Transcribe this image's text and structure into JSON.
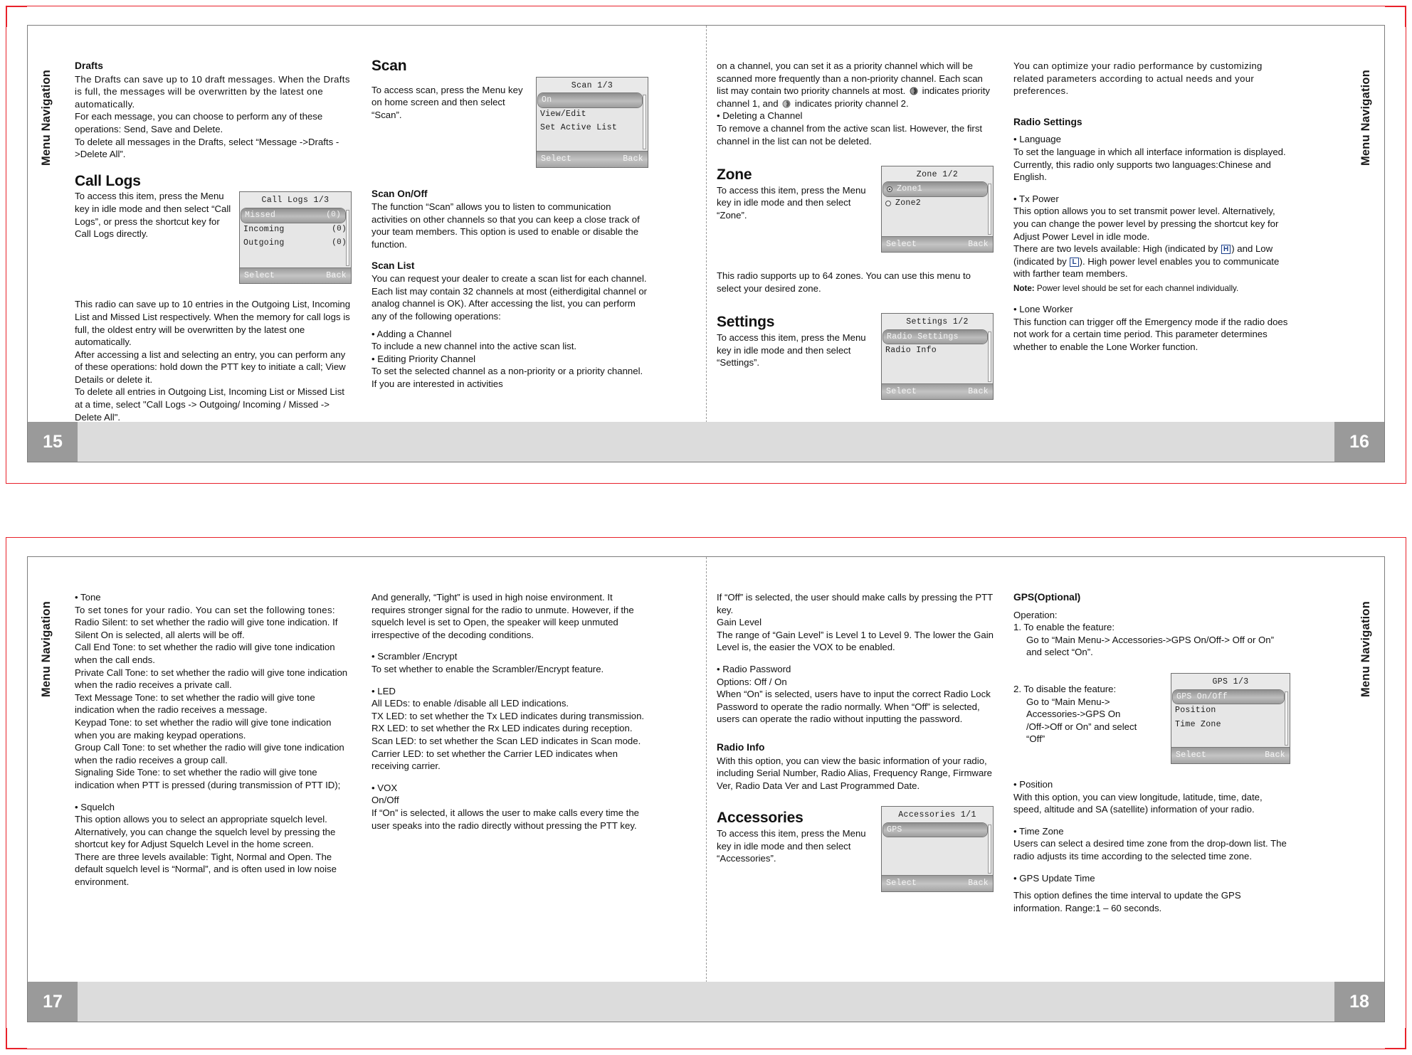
{
  "sidetabs": {
    "label": "Menu Navigation"
  },
  "pages": {
    "p15": {
      "number": "15",
      "col1": {
        "drafts_heading": "Drafts",
        "drafts_p1": "The Drafts can save up to 10 draft messages. When the Drafts is full, the messages will be overwritten by the latest one automatically.",
        "drafts_p2": "For each message, you can choose to perform any of these operations: Send, Save and Delete.",
        "drafts_p3": "To delete all messages in the Drafts, select “Message ->Drafts ->Delete All”.",
        "calllogs_heading": "Call Logs",
        "calllogs_p1": "To access this item, press the Menu key in idle mode and then select “Call Logs”, or press the shortcut key for Call Logs directly.",
        "calllogs_p2": "This radio can save up to 10 entries in the Outgoing List, Incoming List and Missed List respectively. When the memory for call logs is full, the oldest entry will be overwritten by the latest one automatically.",
        "calllogs_p3": "After accessing a list and selecting an entry, you can perform any of these operations: hold down the PTT key to initiate a call; View Details or delete it.",
        "calllogs_p4": "To delete all entries in Outgoing List, Incoming List or Missed List at a time, select \"Call Logs -> Outgoing/ Incoming / Missed -> Delete All\"."
      },
      "col2": {
        "scan_heading": "Scan",
        "scan_p1": "To access scan, press the Menu key on home screen and then select “Scan”.",
        "scanonoff_heading": "Scan On/Off",
        "scanonoff_p1": "The function “Scan” allows you to listen to communication activities on other channels so that you can keep a close track of your team members. This option is used to enable or disable the function.",
        "scanlist_heading": "Scan List",
        "scanlist_p1": "You can request your dealer to create a scan list for each channel. Each list may contain 32 channels at most (eitherdigital channel or analog channel is OK). After accessing the list, you can perform any of the following operations:",
        "bullet_add": "• Adding a Channel",
        "add_p": "To include a new channel into the active scan list.",
        "bullet_edit": "• Editing Priority Channel",
        "edit_p": "To set the selected channel as a non-priority or a priority channel. If you are interested in activities"
      },
      "lcd_scan": {
        "title": "Scan 1/3",
        "rows": [
          "On",
          "View/Edit",
          "Set Active List"
        ],
        "selected_index": 0,
        "softkey_left": "Select",
        "softkey_right": "Back"
      },
      "lcd_calllogs": {
        "title": "Call Logs 1/3",
        "rows": [
          {
            "label": "Missed",
            "count": "(0)"
          },
          {
            "label": "Incoming",
            "count": "(0)"
          },
          {
            "label": "Outgoing",
            "count": "(0)"
          }
        ],
        "selected_index": 0,
        "softkey_left": "Select",
        "softkey_right": "Back"
      }
    },
    "p16": {
      "number": "16",
      "col1": {
        "cont_p1_a": "on a channel, you can set it as a priority channel which will be scanned more frequently than a non-priority channel. Each scan list may contain two priority channels at most.",
        "cont_p1_b": "indicates priority channel 1, and",
        "cont_p1_c": "indicates priority channel 2.",
        "bullet_delete": "• Deleting a Channel",
        "delete_p": "To remove a channel from the active scan list. However, the first channel in the list can not be deleted.",
        "zone_heading": "Zone",
        "zone_p1": "To access this item, press the Menu key in idle mode and then select “Zone”.",
        "zone_p2": "This radio supports up to 64 zones. You can use this menu to select your desired zone.",
        "settings_heading": "Settings",
        "settings_p1": "To access this item, press the Menu key in idle mode and then select “Settings”."
      },
      "col2": {
        "intro_p": "You can optimize your radio performance by customizing related parameters according to actual needs and your preferences.",
        "radiosettings_heading": "Radio Settings",
        "bullet_language": "• Language",
        "language_p": "To set the language in which all interface information is displayed. Currently, this radio only supports two languages:Chinese and English.",
        "bullet_txpower": "• Tx Power",
        "txpower_p1": "This option allows you to set transmit power level. Alternatively, you can change the power level by pressing the shortcut key for Adjust Power Level in idle mode.",
        "txpower_p2_a": "There are two levels available: High (indicated by",
        "txpower_icon_high": "H",
        "txpower_p2_b": ") and Low (indicated by",
        "txpower_icon_low": "L",
        "txpower_p2_c": "). High power level enables you to communicate with farther team members.",
        "note_label": "Note:",
        "note_text": " Power level should be set for each channel individually.",
        "bullet_loneworker": "• Lone Worker",
        "loneworker_p": "This function can trigger off the Emergency mode if the radio does not work for a certain time period. This parameter determines whether to enable the Lone Worker function."
      },
      "lcd_zone": {
        "title": "Zone 1/2",
        "rows": [
          "Zone1",
          "Zone2"
        ],
        "selected_index": 0,
        "softkey_left": "Select",
        "softkey_right": "Back"
      },
      "lcd_settings": {
        "title": "Settings 1/2",
        "rows": [
          "Radio Settings",
          "Radio Info"
        ],
        "selected_index": 0,
        "softkey_left": "Select",
        "softkey_right": "Back"
      }
    },
    "p17": {
      "number": "17",
      "col1": {
        "bullet_tone": "• Tone",
        "tone_p1": "To set tones for your radio. You can set the following tones:",
        "tone_p2": "Radio Silent: to set whether the radio will give tone indication. If Silent On is selected, all alerts will be off.",
        "tone_p3": "Call End Tone: to set whether the radio will give tone indication when the call ends.",
        "tone_p4": "Private Call Tone: to set whether the radio will give tone indication when the radio receives a private call.",
        "tone_p5": "Text Message Tone: to set whether the radio will give tone indication when the radio receives a message.",
        "tone_p6": "Keypad Tone: to set whether the radio will give tone indication when you are making keypad operations.",
        "tone_p7": "Group Call Tone: to set whether the radio will give tone indication when the radio receives a group call.",
        "tone_p8": "Signaling Side Tone: to set whether the radio will give tone indication  when PTT is pressed (during transmission of PTT ID);",
        "bullet_squelch": "• Squelch",
        "squelch_p1": "This option allows you to select an appropriate squelch level. Alternatively, you can change the squelch level by pressing the shortcut key for Adjust Squelch Level in the home screen.",
        "squelch_p2": "There are three levels available: Tight, Normal and Open. The default squelch level is “Normal”, and is often used in low noise environment."
      },
      "col2": {
        "cont_p": "And generally, “Tight” is used in high noise environment. It requires stronger signal for the radio to unmute. However, if the squelch level is set to Open, the speaker will keep unmuted irrespective of the decoding conditions.",
        "bullet_scrambler": "• Scrambler /Encrypt",
        "scrambler_p": "To set whether to enable the Scrambler/Encrypt feature.",
        "bullet_led": "• LED",
        "led_p1": "All LEDs: to enable /disable all LED indications.",
        "led_p2": "TX LED: to set whether the Tx LED indicates during transmission.",
        "led_p3": "RX LED: to set whether the Rx LED indicates during reception.",
        "led_p4": "Scan LED: to set whether the Scan LED indicates in Scan mode.",
        "led_p5": "Carrier LED: to set whether the Carrier LED indicates when receiving carrier.",
        "bullet_vox": "• VOX",
        "vox_p1": "On/Off",
        "vox_p2": "If “On” is selected, it allows the user to make calls every time the user speaks into the radio directly without pressing the PTT key."
      }
    },
    "p18": {
      "number": "18",
      "col1": {
        "vox_cont_p1": "If “Off” is selected, the user should make calls by pressing the PTT key.",
        "vox_cont_p2": "Gain Level",
        "vox_cont_p3": "The range of “Gain Level” is Level 1 to Level 9. The lower the Gain Level is, the easier the VOX to be enabled.",
        "bullet_password": "• Radio Password",
        "password_p1": "Options: Off / On",
        "password_p2": "When “On” is selected, users have to input the correct Radio Lock Password to operate the radio normally. When “Off” is selected, users can operate the radio without inputting the password.",
        "radioinfo_heading": "Radio  Info",
        "radioinfo_p": "With this option, you can view the basic information of your radio, including Serial Number, Radio Alias, Frequency Range, Firmware Ver, Radio Data Ver and Last Programmed Date.",
        "accessories_heading": "Accessories",
        "accessories_p": "To access this item, press the Menu key in idle mode and then select “Accessories”."
      },
      "col2": {
        "gps_heading": "GPS(Optional)",
        "gps_operation": "Operation:",
        "gps_step1_a": "1. To enable the feature:",
        "gps_step1_b": "Go to “Main Menu-> Accessories->GPS On/Off-> Off or On” and select “On”.",
        "gps_step2_a": "2. To disable the feature:",
        "gps_step2_b": "Go to “Main Menu->",
        "gps_step2_c": "Accessories->GPS On",
        "gps_step2_d": "/Off->Off or On” and select",
        "gps_step2_e": "“Off”",
        "bullet_position": "• Position",
        "position_p": "With this option, you can view longitude, latitude, time, date, speed, altitude and SA (satellite) information of your radio.",
        "bullet_timezone": "• Time Zone",
        "timezone_p": "Users can select a desired time zone from the drop-down list. The radio adjusts its time according to the selected time zone.",
        "bullet_gpsupdate": "• GPS Update Time",
        "gpsupdate_p": "This option defines the time interval to update the GPS information. Range:1 – 60 seconds."
      },
      "lcd_accessories": {
        "title": "Accessories 1/1",
        "rows": [
          "GPS"
        ],
        "selected_index": 0,
        "softkey_left": "Select",
        "softkey_right": "Back"
      },
      "lcd_gps": {
        "title": "GPS 1/3",
        "rows": [
          "GPS On/Off",
          "Position",
          "Time Zone"
        ],
        "selected_index": 0,
        "softkey_left": "Select",
        "softkey_right": "Back"
      }
    }
  },
  "colors": {
    "crop_red": "#e8212a",
    "folio_gray": "#9a9a9a",
    "folio_bar": "#dcdcdc",
    "lcd_bg": "#e6e6e6",
    "icon_blue": "#1b3f8b"
  }
}
